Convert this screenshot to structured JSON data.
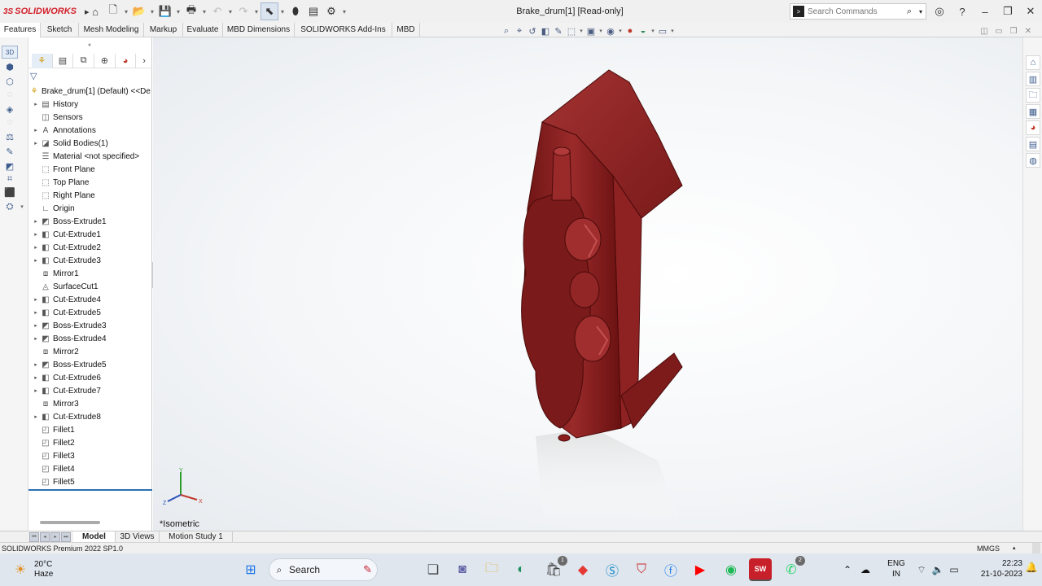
{
  "titlebar": {
    "app_name": "SOLIDWORKS",
    "document_title": "Brake_drum[1] [Read-only]",
    "search_placeholder": "Search Commands"
  },
  "command_tabs": [
    {
      "label": "Features",
      "active": true
    },
    {
      "label": "Sketch"
    },
    {
      "label": "Mesh Modeling"
    },
    {
      "label": "Markup"
    },
    {
      "label": "Evaluate"
    },
    {
      "label": "MBD Dimensions"
    },
    {
      "label": "SOLIDWORKS Add-Ins"
    },
    {
      "label": "MBD"
    }
  ],
  "feature_tree": {
    "root": "Brake_drum[1] (Default) <<De",
    "nodes": [
      {
        "label": "History",
        "icon": "folder-icon",
        "expandable": true
      },
      {
        "label": "Sensors",
        "icon": "sensor-icon",
        "expandable": false
      },
      {
        "label": "Annotations",
        "icon": "annotation-icon",
        "expandable": true
      },
      {
        "label": "Solid Bodies(1)",
        "icon": "solid-bodies-icon",
        "expandable": true
      },
      {
        "label": "Material <not specified>",
        "icon": "material-icon",
        "expandable": false
      },
      {
        "label": "Front Plane",
        "icon": "plane-icon",
        "expandable": false
      },
      {
        "label": "Top Plane",
        "icon": "plane-icon",
        "expandable": false
      },
      {
        "label": "Right Plane",
        "icon": "plane-icon",
        "expandable": false
      },
      {
        "label": "Origin",
        "icon": "origin-icon",
        "expandable": false
      },
      {
        "label": "Boss-Extrude1",
        "icon": "boss-extrude-icon",
        "expandable": true
      },
      {
        "label": "Cut-Extrude1",
        "icon": "cut-extrude-icon",
        "expandable": true
      },
      {
        "label": "Cut-Extrude2",
        "icon": "cut-extrude-icon",
        "expandable": true
      },
      {
        "label": "Cut-Extrude3",
        "icon": "cut-extrude-icon",
        "expandable": true
      },
      {
        "label": "Mirror1",
        "icon": "mirror-icon",
        "expandable": false
      },
      {
        "label": "SurfaceCut1",
        "icon": "surface-cut-icon",
        "expandable": false
      },
      {
        "label": "Cut-Extrude4",
        "icon": "cut-extrude-icon",
        "expandable": true
      },
      {
        "label": "Cut-Extrude5",
        "icon": "cut-extrude-icon",
        "expandable": true
      },
      {
        "label": "Boss-Extrude3",
        "icon": "boss-extrude-icon",
        "expandable": true
      },
      {
        "label": "Boss-Extrude4",
        "icon": "boss-extrude-icon",
        "expandable": true
      },
      {
        "label": "Mirror2",
        "icon": "mirror-icon",
        "expandable": false
      },
      {
        "label": "Boss-Extrude5",
        "icon": "boss-extrude-icon",
        "expandable": true
      },
      {
        "label": "Cut-Extrude6",
        "icon": "cut-extrude-icon",
        "expandable": true
      },
      {
        "label": "Cut-Extrude7",
        "icon": "cut-extrude-icon",
        "expandable": true
      },
      {
        "label": "Mirror3",
        "icon": "mirror-icon",
        "expandable": false
      },
      {
        "label": "Cut-Extrude8",
        "icon": "cut-extrude-icon",
        "expandable": true
      },
      {
        "label": "Fillet1",
        "icon": "fillet-icon",
        "expandable": false
      },
      {
        "label": "Fillet2",
        "icon": "fillet-icon",
        "expandable": false
      },
      {
        "label": "Fillet3",
        "icon": "fillet-icon",
        "expandable": false
      },
      {
        "label": "Fillet4",
        "icon": "fillet-icon",
        "expandable": false
      },
      {
        "label": "Fillet5",
        "icon": "fillet-icon",
        "expandable": false
      }
    ]
  },
  "graphics": {
    "view_label": "*Isometric",
    "part_color": "#8a1c1c",
    "triad_labels": {
      "x": "X",
      "y": "Y",
      "z": "Z"
    }
  },
  "model_tabs": [
    {
      "label": "Model",
      "active": true
    },
    {
      "label": "3D Views"
    },
    {
      "label": "Motion Study 1"
    }
  ],
  "statusbar": {
    "product": "SOLIDWORKS Premium 2022 SP1.0",
    "units": "MMGS"
  },
  "taskbar": {
    "weather_temp": "20°C",
    "weather_desc": "Haze",
    "search_label": "Search",
    "store_badge": "1",
    "whatsapp_badge": "2",
    "sw_app_text": "SW",
    "language_1": "ENG",
    "language_2": "IN",
    "time": "22:23",
    "date": "21-10-2023"
  }
}
